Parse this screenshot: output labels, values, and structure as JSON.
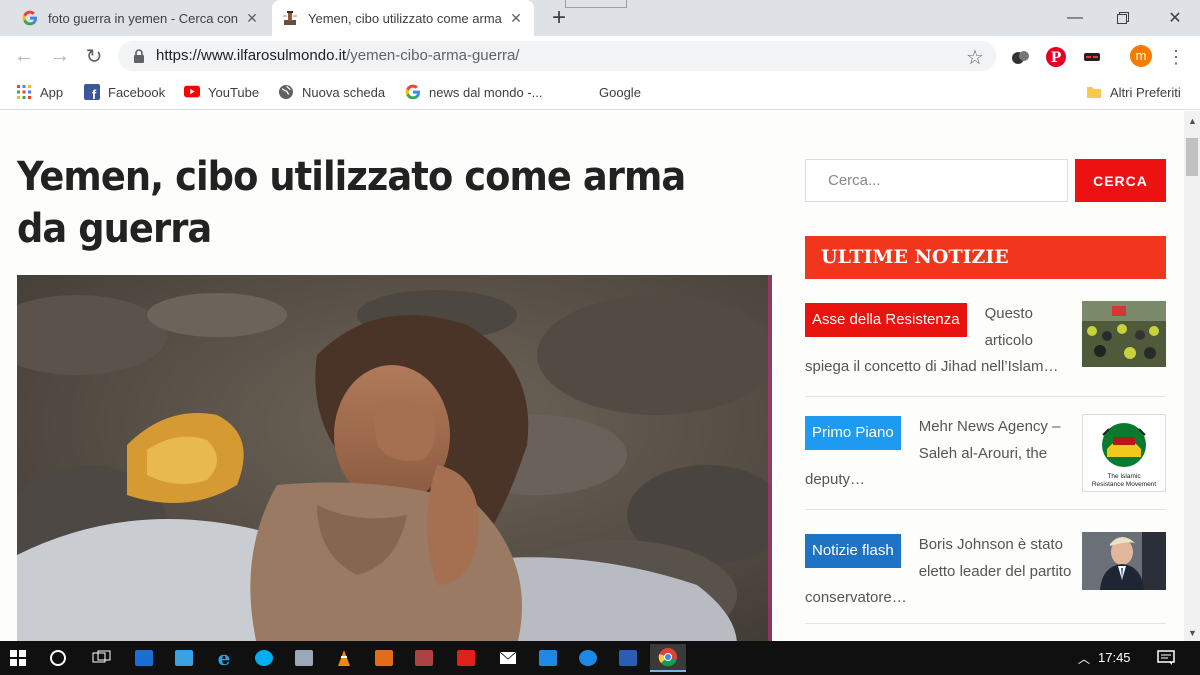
{
  "tabs": [
    {
      "title": "foto guerra in yemen - Cerca con Google",
      "active": false,
      "favicon": "google-g-icon"
    },
    {
      "title": "Yemen, cibo utilizzato come arma da guerra",
      "active": true,
      "favicon": "site-lighthouse-icon"
    }
  ],
  "toolbar": {
    "url_host": "https://www.ilfarosulmondo.it",
    "url_path": "/yemen-cibo-arma-guerra/",
    "profile_initial": "m"
  },
  "bookmarks": [
    {
      "label": "App",
      "icon": "apps-grid-icon"
    },
    {
      "label": "Facebook",
      "icon": "facebook-icon"
    },
    {
      "label": "YouTube",
      "icon": "youtube-icon"
    },
    {
      "label": "Nuova scheda",
      "icon": "globe-icon"
    },
    {
      "label": "news dal mondo -...",
      "icon": "google-g-icon"
    },
    {
      "label": "Google",
      "icon": ""
    },
    {
      "label": "Altri Preferiti",
      "icon": "folder-icon"
    }
  ],
  "article": {
    "title": "Yemen, cibo utilizzato come arma da guerra"
  },
  "sidebar": {
    "search_placeholder": "Cerca...",
    "search_button": "CERCA",
    "latest_heading": "ULTIME NOTIZIE",
    "news": [
      {
        "category": "Asse della Resistenza",
        "badge_color": "#e8140f",
        "excerpt": "Questo articolo spiega il concetto di Jihad nell’Islam…"
      },
      {
        "category": "Primo Piano",
        "badge_color": "#1e9bf0",
        "excerpt": "Mehr News Agency – Saleh al-Arouri, the deputy…"
      },
      {
        "category": "Notizie flash",
        "badge_color": "#1f73c4",
        "excerpt": "Boris Johnson è stato eletto leader del partito conservatore…"
      }
    ],
    "thumb_caption": "The Islamic Resistance Movement"
  },
  "taskbar": {
    "clock": "17:45"
  }
}
